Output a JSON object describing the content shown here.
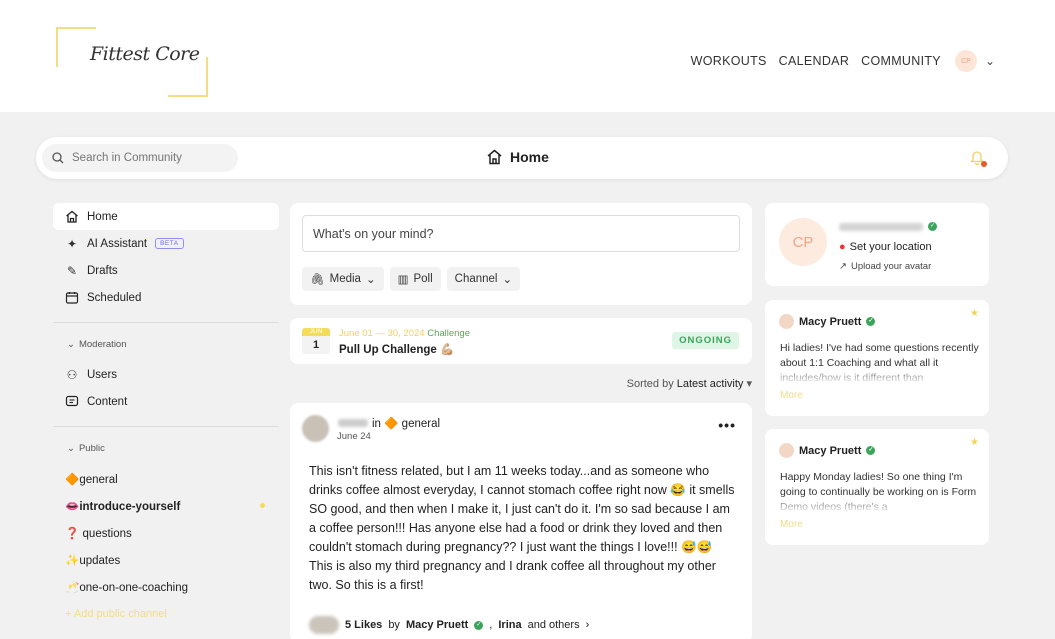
{
  "brand": {
    "logo_text": "Fittest Core"
  },
  "topnav": {
    "items": [
      "WORKOUTS",
      "CALENDAR",
      "COMMUNITY"
    ],
    "avatar_initials": "CP"
  },
  "header": {
    "search_placeholder": "Search in Community",
    "title": "Home"
  },
  "sidebar": {
    "main_items": [
      {
        "label": "Home",
        "icon": "home-icon"
      },
      {
        "label": "AI Assistant",
        "icon": "sparkle-icon",
        "badge": "BETA"
      },
      {
        "label": "Drafts",
        "icon": "pencil-icon"
      },
      {
        "label": "Scheduled",
        "icon": "calendar-icon"
      }
    ],
    "moderation_title": "Moderation",
    "moderation_items": [
      {
        "label": "Users",
        "icon": "users-icon"
      },
      {
        "label": "Content",
        "icon": "content-icon"
      }
    ],
    "public_title": "Public",
    "channels": [
      {
        "label": "general",
        "emoji": "🔶"
      },
      {
        "label": "introduce-yourself",
        "emoji": "👄",
        "unread": true
      },
      {
        "label": "questions",
        "emoji": "❓"
      },
      {
        "label": "updates",
        "emoji": "✨"
      },
      {
        "label": "one-on-one-coaching",
        "emoji": "🥂"
      }
    ],
    "add_channel": "+ Add public channel"
  },
  "composer": {
    "placeholder": "What's on your mind?",
    "media": "Media",
    "poll": "Poll",
    "channel": "Channel"
  },
  "challenge": {
    "month": "JUN",
    "day": "1",
    "dates": "June 01 — 30, 2024",
    "type": "Challenge",
    "title": "Pull Up Challenge 💪🏼",
    "status": "ONGOING"
  },
  "sort": {
    "prefix": "Sorted by",
    "value": "Latest activity"
  },
  "post": {
    "in_label": "in",
    "channel": "🔶 general",
    "date": "June 24",
    "body": "This isn't fitness related, but I am 11 weeks today...and as someone who drinks coffee almost everyday, I cannot stomach coffee right now 😂 it smells SO good, and then when I make it, I just can't do it. I'm so sad because I am a coffee person!!! Has anyone else had a food or drink they loved and then couldn't stomach during pregnancy?? I just want the things I love!!! 😅😅 This is also my third pregnancy and I drank coffee all throughout my other two. So this is a first!",
    "likes_count": "5 Likes",
    "likes_by": "by",
    "liker1": "Macy Pruett",
    "liker2": "Irina",
    "likes_rest": "and others"
  },
  "profile": {
    "initials": "CP",
    "location": "Set your location",
    "upload": "Upload your avatar"
  },
  "cards": [
    {
      "author": "Macy Pruett",
      "text": "Hi ladies! I've had some questions recently about 1:1 Coaching and what all it includes/how is it different than",
      "more": "More"
    },
    {
      "author": "Macy Pruett",
      "text": "Happy Monday ladies! So one thing I'm going to continually be working on is Form Demo videos (there's a",
      "more": "More"
    }
  ],
  "colors": {
    "accent": "#f3dc86",
    "verified": "#3aa55a",
    "bell_dot": "#e55a2b"
  }
}
